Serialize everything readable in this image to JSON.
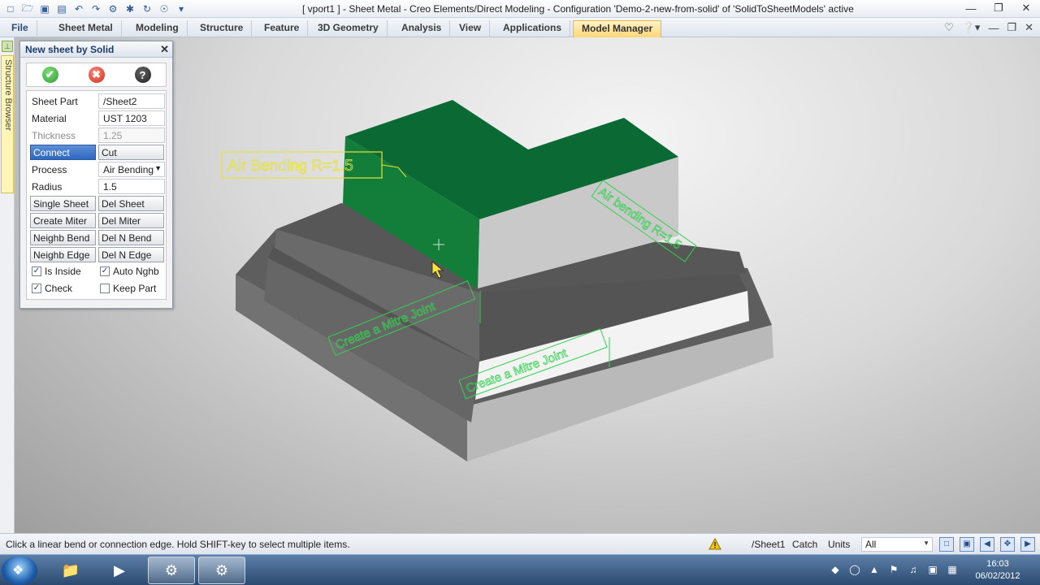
{
  "window": {
    "title": "[ vport1 ] - Sheet Metal - Creo Elements/Direct Modeling - Configuration 'Demo-2-new-from-solid' of 'SolidToSheetModels' active",
    "minimize_icon": "minimize-icon",
    "restore_icon": "restore-icon",
    "close_icon": "close-icon"
  },
  "quick_access": [
    "new-icon",
    "open-icon",
    "save-icon",
    "print-preview-icon",
    "undo-icon",
    "redo-icon",
    "tools-icon",
    "settings-icon",
    "refresh-icon",
    "view-icon",
    "customize-icon"
  ],
  "ribbon": {
    "tabs": [
      {
        "label": "File",
        "active": false
      },
      {
        "label": "Sheet Metal",
        "active": false
      },
      {
        "label": "Modeling",
        "active": false
      },
      {
        "label": "Structure",
        "active": false
      },
      {
        "label": "Feature",
        "active": false
      },
      {
        "label": "3D Geometry",
        "active": false
      },
      {
        "label": "Analysis",
        "active": false
      },
      {
        "label": "View",
        "active": false
      },
      {
        "label": "Applications",
        "active": false
      },
      {
        "label": "Model Manager",
        "active": true
      }
    ]
  },
  "structure_browser": {
    "label": "Structure Browser"
  },
  "dialog": {
    "title": "New sheet by Solid",
    "fields": {
      "sheet_part": {
        "label": "Sheet Part",
        "value": "/Sheet2"
      },
      "material": {
        "label": "Material",
        "value": "UST 1203"
      },
      "thickness": {
        "label": "Thickness",
        "value": "1.25"
      },
      "process": {
        "label": "Process",
        "value": "Air Bending"
      },
      "radius": {
        "label": "Radius",
        "value": "1.5"
      }
    },
    "buttons": {
      "connect": "Connect",
      "cut": "Cut",
      "single_sheet": "Single Sheet",
      "del_sheet": "Del Sheet",
      "create_miter": "Create Miter",
      "del_miter": "Del Miter",
      "neighb_bend": "Neighb Bend",
      "del_n_bend": "Del N Bend",
      "neighb_edge": "Neighb Edge",
      "del_n_edge": "Del N Edge"
    },
    "checkboxes": {
      "is_inside": {
        "label": "Is Inside",
        "checked": true
      },
      "auto_nghb": {
        "label": "Auto Nghb",
        "checked": true
      },
      "check": {
        "label": "Check",
        "checked": true
      },
      "keep_part": {
        "label": "Keep Part",
        "checked": false
      }
    }
  },
  "annotations": {
    "air_bending_left": "Air Bending R=1.5",
    "air_bending_right": "Air bending R=1.5",
    "mitre_1": "Create a Mitre Joint",
    "mitre_2": "Create a Mitre Joint"
  },
  "status": {
    "message": "Click a linear bend or connection edge. Hold SHIFT-key to select multiple items.",
    "part": "/Sheet1",
    "catch": "Catch",
    "units": "Units",
    "filter": "All"
  },
  "clock": {
    "time": "16:03",
    "date": "06/02/2012"
  },
  "colors": {
    "selected_face": "#0b6a34",
    "annotation_green": "#33d14f",
    "annotation_yellow": "#e8e23a"
  }
}
